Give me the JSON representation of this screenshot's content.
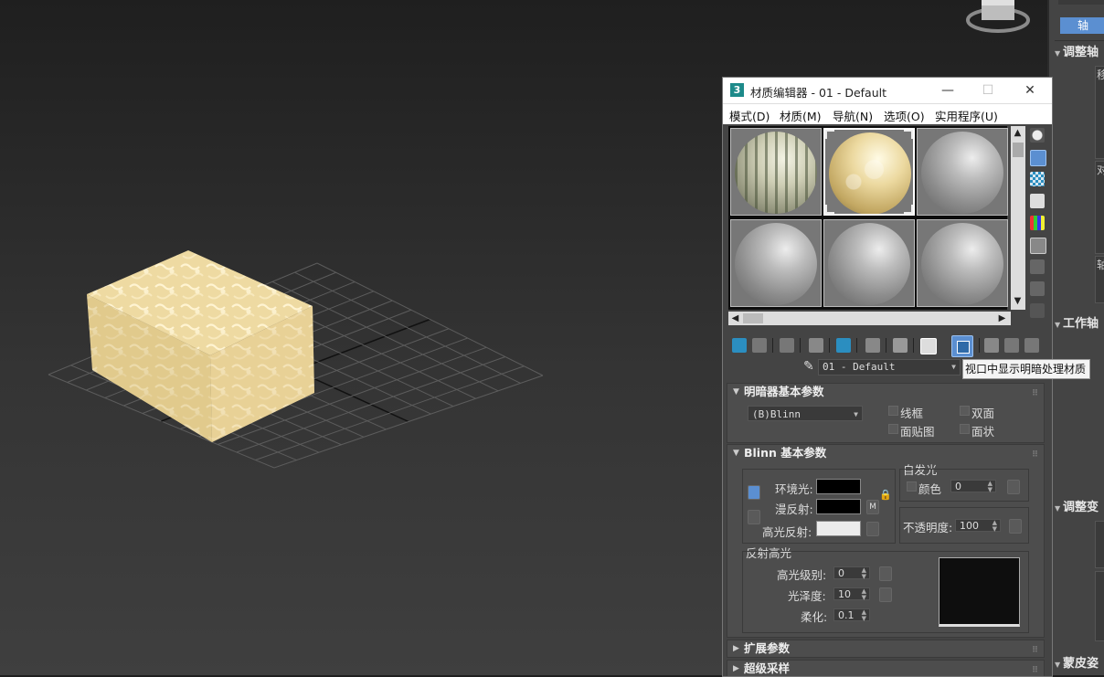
{
  "command_panel": {
    "tab_label": "轴",
    "sections": [
      "调整轴",
      "工作轴",
      "调整变",
      "蒙皮姿"
    ],
    "side_chars": [
      "移",
      "对",
      "轴"
    ]
  },
  "material_editor": {
    "title": "材质编辑器 - 01 - Default",
    "logo": "3",
    "window_buttons": {
      "minimize": "—",
      "maximize": "☐",
      "close": "✕"
    },
    "menus": [
      "模式(D)",
      "材质(M)",
      "导航(N)",
      "选项(O)",
      "实用程序(U)"
    ],
    "slots": [
      "stripe",
      "cream",
      "gray",
      "gray",
      "gray",
      "gray"
    ],
    "selected_slot": 1,
    "current_material": "01 - Default",
    "tooltip": "视口中显示明暗处理材质",
    "shader_rollout": {
      "title": "明暗器基本参数",
      "shader": "(B)Blinn",
      "options": [
        "线框",
        "双面",
        "面贴图",
        "面状"
      ]
    },
    "blinn_rollout": {
      "title": "Blinn 基本参数",
      "ambient_label": "环境光:",
      "diffuse_label": "漫反射:",
      "specular_label": "高光反射:",
      "lock_map_label": "M",
      "self_illum_title": "自发光",
      "self_illum_color_label": "颜色",
      "self_illum_value": "0",
      "opacity_label": "不透明度:",
      "opacity_value": "100",
      "spec_title": "反射高光",
      "spec_level_label": "高光级别:",
      "spec_level_value": "0",
      "gloss_label": "光泽度:",
      "gloss_value": "10",
      "soften_label": "柔化:",
      "soften_value": "0.1"
    },
    "extended_rollout": "扩展参数",
    "supersampling_rollout": "超级采样"
  },
  "colors": {
    "ambient": "#000000",
    "diffuse": "#000000",
    "specular": "#ececec",
    "accent": "#5b8fd1",
    "annotation_arrow": "#e8322e"
  }
}
